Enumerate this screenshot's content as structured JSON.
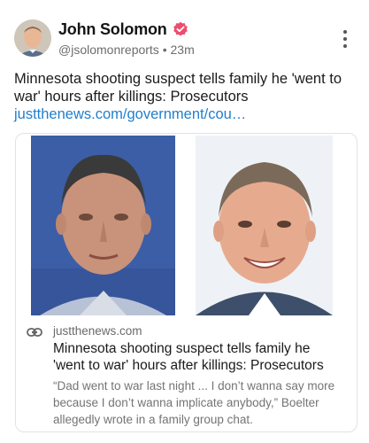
{
  "post": {
    "author_name": "John Solomon",
    "handle": "@jsolomonreports",
    "separator": "•",
    "time": "23m",
    "text": "Minnesota shooting suspect tells family he 'went to war' hours after killings: Prosecutors",
    "link_text": "justthenews.com/government/cou…"
  },
  "card": {
    "domain": "justthenews.com",
    "title": "Minnesota shooting suspect tells family he 'went to war' hours after killings: Prosecutors",
    "description": "“Dad went to war last night ... I don’t wanna say more because I don’t wanna implicate anybody,” Boelter allegedly wrote in a family group chat."
  },
  "icons": {
    "verified": "verified-badge-icon",
    "more": "more-options-icon",
    "link": "link-icon"
  },
  "colors": {
    "link": "#1f7fce",
    "verified": "#ee4d6e",
    "photo_left_bg": "#3b5ea6"
  }
}
